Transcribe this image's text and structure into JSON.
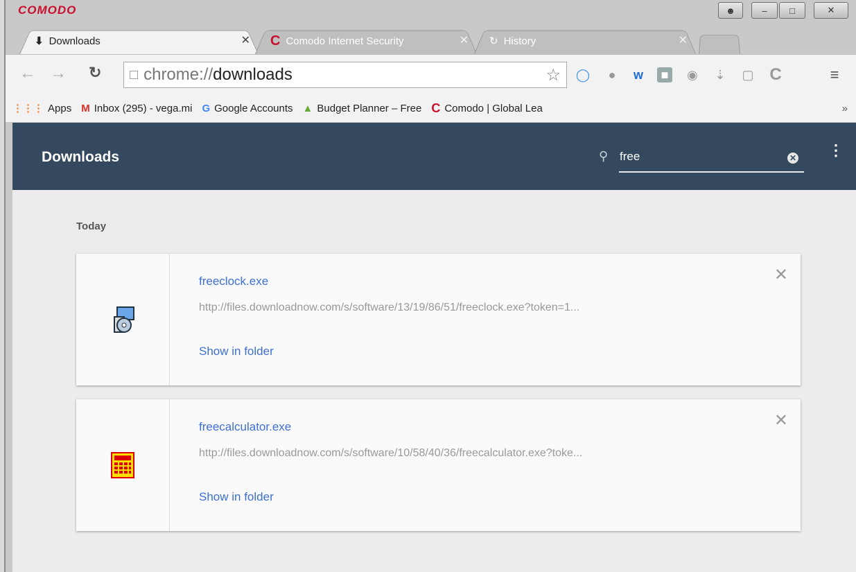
{
  "window": {
    "brand": "COMODO",
    "controls": [
      "Ω",
      "–",
      "□",
      "✕"
    ]
  },
  "tabs": [
    {
      "label": "Downloads",
      "icon": "download-icon",
      "active": true
    },
    {
      "label": "Comodo Internet Security",
      "icon": "comodo-icon",
      "active": false
    },
    {
      "label": "History",
      "icon": "history-icon",
      "active": false
    }
  ],
  "toolbar": {
    "address_scheme": "chrome://",
    "address_path": "downloads"
  },
  "bookmarks": [
    {
      "label": "Apps",
      "icon": "apps-icon"
    },
    {
      "label": "Inbox (295) - vega.mi",
      "icon": "gmail-icon"
    },
    {
      "label": "Google Accounts",
      "icon": "google-icon"
    },
    {
      "label": "Budget Planner – Free",
      "icon": "budget-icon"
    },
    {
      "label": "Comodo | Global Lea",
      "icon": "comodo-icon"
    }
  ],
  "header": {
    "title": "Downloads",
    "search_value": "free"
  },
  "section_label": "Today",
  "downloads": [
    {
      "name": "freeclock.exe",
      "url": "http://files.downloadnow.com/s/software/13/19/86/51/freeclock.exe?token=1...",
      "action": "Show in folder",
      "icon": "installer-icon"
    },
    {
      "name": "freecalculator.exe",
      "url": "http://files.downloadnow.com/s/software/10/58/40/36/freecalculator.exe?toke...",
      "action": "Show in folder",
      "icon": "calculator-icon"
    }
  ],
  "colors": {
    "header_bg": "#34495e",
    "link": "#3d6fd3",
    "brand": "#c8102e"
  }
}
